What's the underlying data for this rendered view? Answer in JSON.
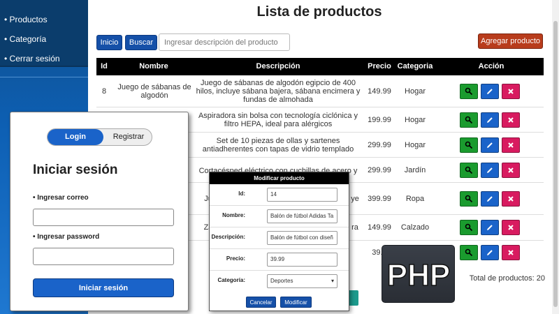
{
  "sidebar": {
    "items": [
      {
        "label": "• Productos"
      },
      {
        "label": "• Categoría"
      },
      {
        "label": "• Cerrar sesión"
      }
    ]
  },
  "main": {
    "title": "Lista de productos",
    "buttons": {
      "inicio": "Inicio",
      "buscar": "Buscar",
      "agregar": "Agregar producto"
    },
    "search": {
      "placeholder": "Ingresar descripción del producto"
    },
    "table": {
      "columns": [
        "Id",
        "Nombre",
        "Descripción",
        "Precio",
        "Categoria",
        "Acción"
      ],
      "rows": [
        {
          "id": "8",
          "nombre": "Juego de sábanas de algodón",
          "descripcion": "Juego de sábanas de algodón egipcio de 400 hilos, incluye sábana bajera, sábana encimera y fundas de almohada",
          "precio": "149.99",
          "categoria": "Hogar"
        },
        {
          "id": "",
          "nombre": "",
          "descripcion": "Aspiradora sin bolsa con tecnología ciclónica y filtro HEPA, ideal para alérgicos",
          "precio": "199.99",
          "categoria": "Hogar"
        },
        {
          "id": "",
          "nombre": "",
          "descripcion": "Set de 10 piezas de ollas y sartenes antiadherentes con tapas de vidrio templado",
          "precio": "299.99",
          "categoria": "Hogar"
        },
        {
          "id": "",
          "nombre": "",
          "descripcion": "Cortacésped eléctrico con cuchillas de acero y",
          "precio": "299.99",
          "categoria": "Jardín"
        },
        {
          "id": "",
          "nombre": "Ju",
          "descripcion": "ye",
          "precio": "399.99",
          "categoria": "Ropa"
        },
        {
          "id": "",
          "nombre": "Za",
          "descripcion": "ra",
          "precio": "149.99",
          "categoria": "Calzado"
        },
        {
          "id": "",
          "nombre": "",
          "descripcion": "",
          "precio": "39.9",
          "categoria": ""
        }
      ]
    },
    "total": "Total de productos: 20"
  },
  "login": {
    "tabs": {
      "login": "Login",
      "registrar": "Registrar"
    },
    "title": "Iniciar sesión",
    "email_label": "• Ingresar correo",
    "password_label": "• Ingresar password",
    "submit": "Iniciar sesión"
  },
  "modal": {
    "title": "Modificar producto",
    "fields": [
      {
        "label": "Id:",
        "value": "14"
      },
      {
        "label": "Nombre:",
        "value": "Balón de fútbol Adidas Ta"
      },
      {
        "label": "Descripción:",
        "value": "Balón de fútbol con diseñ"
      },
      {
        "label": "Precio:",
        "value": "39.99"
      },
      {
        "label": "Categoría:",
        "value": "Deportes"
      }
    ],
    "cancel": "Cancelar",
    "submit": "Modificar"
  },
  "php_logo": {
    "text": "PHP"
  },
  "colors": {
    "sidebar": "#0d5fb3",
    "primary": "#1550a8",
    "add": "#b83c1c",
    "view": "#1a9b2e",
    "edit": "#1a63c9",
    "delete": "#d81b60"
  }
}
